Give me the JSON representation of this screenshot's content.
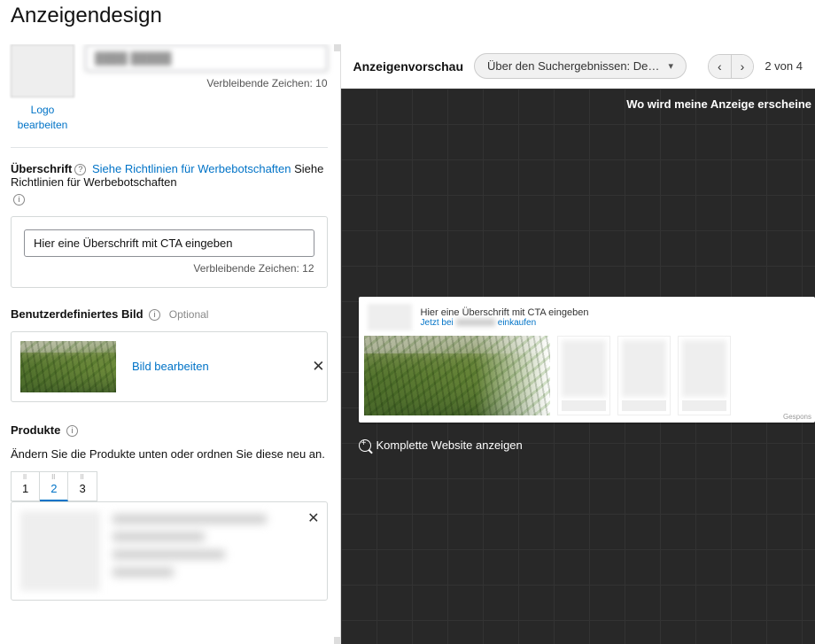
{
  "page": {
    "title": "Anzeigendesign"
  },
  "brand": {
    "name_value": "",
    "chars_remaining_label": "Verbleibende Zeichen: 10",
    "logo_edit": "Logo bearbeiten"
  },
  "headline": {
    "label": "Überschrift",
    "guideline_link": "Siehe Richtlinien für Werbebotschaften",
    "guideline_trail": "Siehe Richtlinien für Werbebotschaften",
    "value": "Hier eine Überschrift mit CTA eingeben",
    "chars_remaining_label": "Verbleibende Zeichen: 12"
  },
  "custom_image": {
    "label": "Benutzerdefiniertes Bild",
    "optional": "Optional",
    "edit_link": "Bild bearbeiten"
  },
  "products": {
    "label": "Produkte",
    "help_text": "Ändern Sie die Produkte unten oder ordnen Sie diese neu an.",
    "tabs": [
      "1",
      "2",
      "3"
    ],
    "active_index": 1
  },
  "preview": {
    "header_label": "Anzeigenvorschau",
    "dropdown_value": "Über den Suchergebnissen: Deskt…",
    "counter": "2 von 4",
    "banner_question": "Wo wird meine Anzeige erscheine",
    "ad_headline": "Hier eine Überschrift mit CTA eingeben",
    "ad_sub_prefix": "Jetzt bei",
    "ad_sub_suffix": "einkaufen",
    "sponsored": "Gespons",
    "zoom_label": "Komplette Website anzeigen"
  }
}
